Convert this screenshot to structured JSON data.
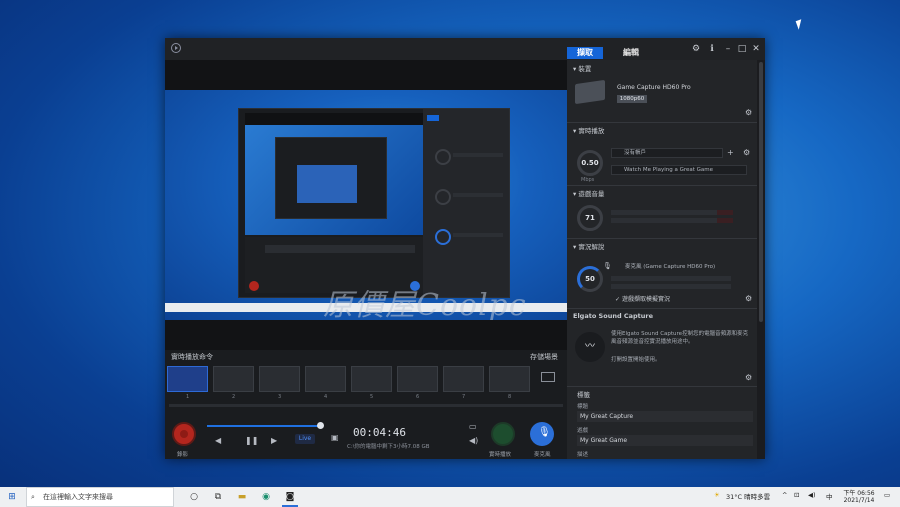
{
  "window": {
    "tabs": [
      {
        "label": "擷取"
      },
      {
        "label": "編輯"
      }
    ]
  },
  "preview": {
    "watermark": "原價屋Coolpc"
  },
  "lower": {
    "scenes_title": "實時播放命令",
    "save_link": "存儲場景",
    "thumb_numbers": [
      "1",
      "2",
      "3",
      "4",
      "5",
      "6",
      "7",
      "8"
    ],
    "live_label": "Live",
    "timecode": "00:04:46",
    "time_sub": "C:\\你的電腦中剩下3小時7.08 GB",
    "record_label": "錄影",
    "stream_label": "實時播放",
    "mic_label": "麥克風"
  },
  "panel": {
    "device_section": "裝置",
    "device_name": "Game Capture HD60 Pro",
    "device_res": "1080p60",
    "stream_section": "實時播放",
    "stream_dial": "0.50",
    "stream_dial_unit": "Mbps",
    "stream_account": "沒有帳戶",
    "stream_title": "Watch Me Playing a Great Game",
    "game_audio_section": "遊戲音量",
    "game_dial": "71",
    "comment_section": "實況解說",
    "mic_dial": "50",
    "mic_device": "麥克風 (Game Capture HD60 Pro)",
    "mic_checkbox": "遊戲擷取模擬實況",
    "sound_capture_title": "Elgato Sound Capture",
    "sound_capture_desc": "使用Elgato Sound Capture控制您的電腦音頻源和麥克風音頻源並音控實況播放用途中。",
    "sound_capture_link": "打開設置開始使用。",
    "tags_section": "標籤",
    "title_label": "標題",
    "title_value": "My Great Capture",
    "game_label": "遊戲",
    "game_value": "My Great Game",
    "desc_label": "描述"
  },
  "taskbar": {
    "search_placeholder": "在這裡輸入文字來搜尋",
    "weather": "31°C 晴時多雲",
    "time": "下午 06:56",
    "date": "2021/7/14"
  }
}
